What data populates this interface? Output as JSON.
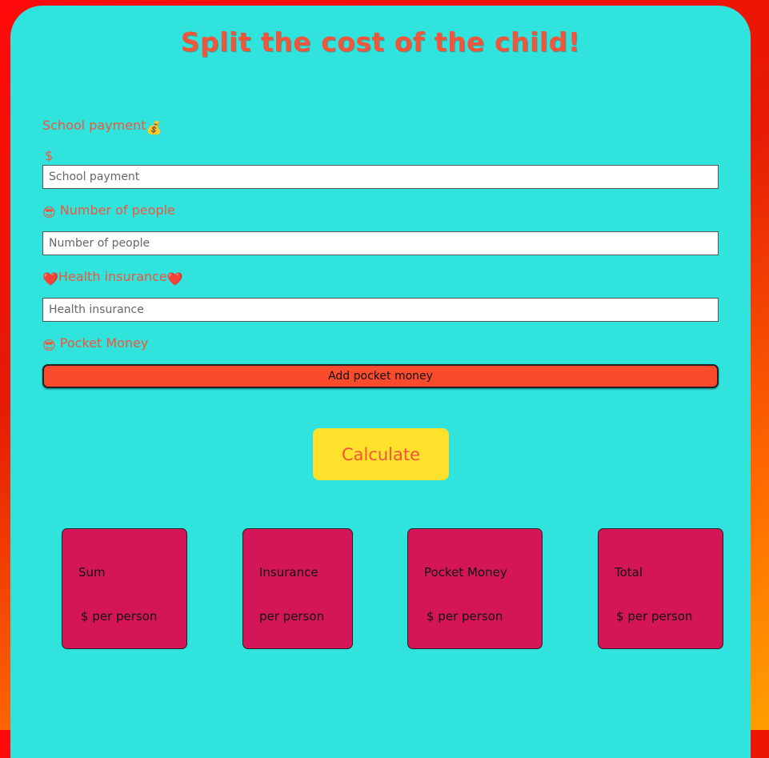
{
  "header": {
    "title": "Split the cost of the child!"
  },
  "form": {
    "school_label": "School payment",
    "school_emoji": "💰",
    "currency": "$",
    "school_placeholder": "School payment",
    "people_emoji": "😎",
    "people_label": "Number of people",
    "people_placeholder": "Number of people",
    "health_emoji": "❤️",
    "health_label": "Health insurance",
    "health_placeholder": "Health insurance",
    "pocket_emoji": "😎",
    "pocket_label": "Pocket Money",
    "add_pocket_button": "Add pocket money",
    "calculate_button": "Calculate"
  },
  "results": {
    "sum": {
      "title": "Sum",
      "currency": "$",
      "suffix": "per person"
    },
    "insurance": {
      "title": "Insurance",
      "suffix": "per person"
    },
    "pocket": {
      "title": "Pocket Money",
      "currency": "$",
      "suffix": "per person"
    },
    "total": {
      "title": "Total",
      "currency": "$",
      "suffix": "per person"
    }
  },
  "colors": {
    "panel": "#31e3dd",
    "accent_text": "#f2553a",
    "add_button": "#fb4b2c",
    "calculate_button": "#fde12b",
    "result_box": "#d41558"
  }
}
